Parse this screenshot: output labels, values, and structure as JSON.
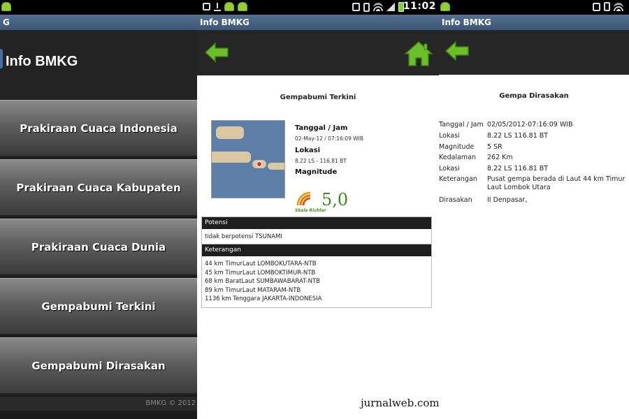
{
  "status_bar": {
    "time": "11:02"
  },
  "colors": {
    "accent_green": "#6dbf2a",
    "title_bar": "#3b5676"
  },
  "panel1": {
    "title_bar": "G",
    "app_title": "Info BMKG",
    "menu": [
      {
        "label": "Prakiraan Cuaca Indonesia"
      },
      {
        "label": "Prakiraan Cuaca Kabupaten"
      },
      {
        "label": "Prakiraan Cuaca Dunia"
      },
      {
        "label": "Gempabumi Terkini"
      },
      {
        "label": "Gempabumi Dirasakan"
      }
    ],
    "footer": "BMKG © 2012"
  },
  "panel2": {
    "title_bar": "Info BMKG",
    "toolbar": {
      "back_icon": "back-arrow-icon",
      "home_icon": "home-icon"
    },
    "heading": "Gempabumi Terkini",
    "labels": {
      "datetime": "Tanggal / Jam",
      "location": "Lokasi",
      "magnitude": "Magnitude"
    },
    "values": {
      "datetime": "02-May-12 / 07:16:09 WIB",
      "location": "8.22 LS - 116.81 BT",
      "magnitude": "5,0",
      "scale": "Skala Richter"
    },
    "potensi": {
      "header": "Potensi",
      "text": "tidak berpotensi TSUNAMI"
    },
    "keterangan": {
      "header": "Keterangan",
      "lines": [
        "44 km TimurLaut LOMBOKUTARA-NTB",
        "45 km TimurLaut LOMBOKTIMUR-NTB",
        "68 km BaratLaut SUMBAWABARAT-NTB",
        "89 km TimurLaut MATARAM-NTB",
        "1136 km Tenggara JAKARTA-INDONESIA"
      ]
    },
    "watermark": "jurnalweb.com"
  },
  "panel3": {
    "title_bar": "Info BMKG",
    "heading": "Gempa Dirasakan",
    "rows": [
      {
        "label": "Tanggal / Jam",
        "value": "02/05/2012-07:16:09 WIB"
      },
      {
        "label": "Lokasi",
        "value": "8.22 LS 116.81 BT"
      },
      {
        "label": "Magnitude",
        "value": "5 SR"
      },
      {
        "label": "Kedalaman",
        "value": "262 Km"
      },
      {
        "label": "Lokasi",
        "value": "8.22 LS 116.81 BT"
      },
      {
        "label": "Keterangan",
        "value": "Pusat gempa berada di Laut 44 km Timur Laut Lombok Utara"
      },
      {
        "label": "Dirasakan",
        "value": "II Denpasar,"
      }
    ]
  }
}
